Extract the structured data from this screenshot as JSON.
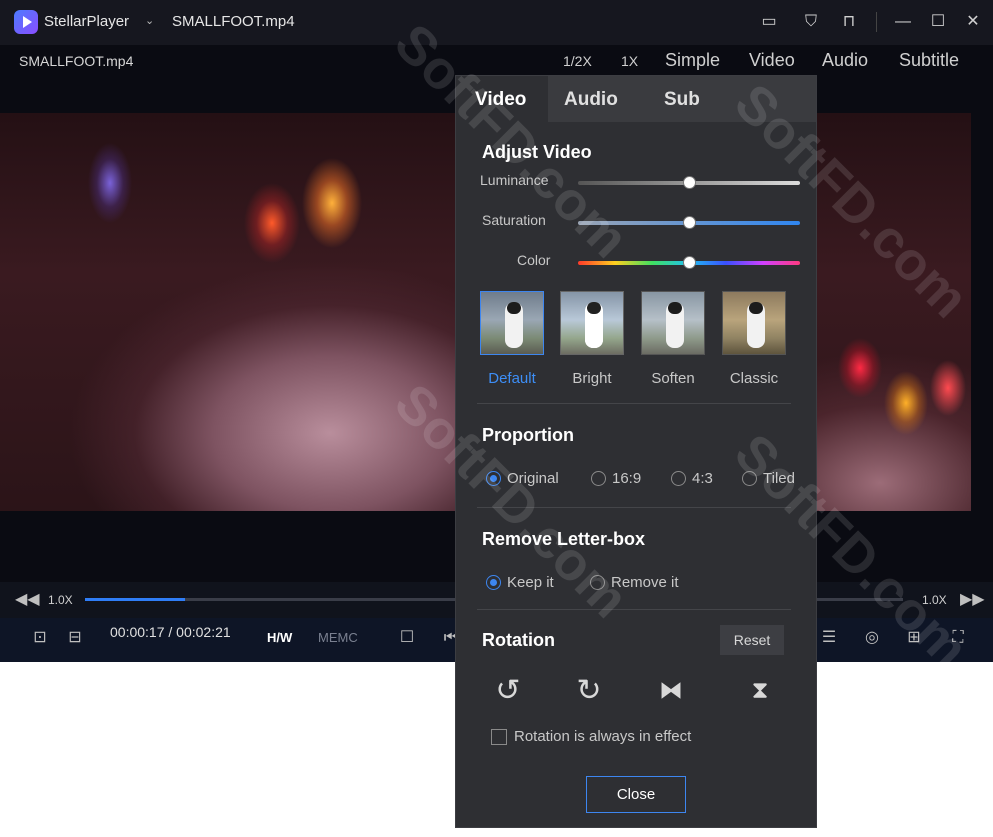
{
  "titlebar": {
    "app_name": "StellarPlayer",
    "file_title": "SMALLFOOT.mp4",
    "icons": [
      "feedback-icon",
      "skin-icon",
      "pin-icon",
      "minimize-icon",
      "maximize-icon",
      "close-icon"
    ]
  },
  "menu": {
    "file_label": "SMALLFOOT.mp4",
    "modes": [
      "1/2X",
      "1X",
      "Simple",
      "Video",
      "Audio",
      "Subtitle"
    ]
  },
  "progress": {
    "left_speed": "1.0X",
    "right_speed": "1.0X",
    "played_fraction": 0.27
  },
  "controls": {
    "time": "00:00:17 / 00:02:21",
    "hw": "H/W",
    "memc": "MEMC"
  },
  "panel": {
    "tabs": [
      "Video",
      "Audio",
      "Sub"
    ],
    "adjust_title": "Adjust Video",
    "sliders": [
      {
        "label": "Luminance",
        "value": 0.5
      },
      {
        "label": "Saturation",
        "value": 0.5
      },
      {
        "label": "Color",
        "value": 0.5
      }
    ],
    "presets": [
      "Default",
      "Bright",
      "Soften",
      "Classic"
    ],
    "proportion_title": "Proportion",
    "proportion_options": [
      "Original",
      "16:9",
      "4:3",
      "Tiled"
    ],
    "letterbox_title": "Remove Letter-box",
    "letterbox_options": [
      "Keep it",
      "Remove it"
    ],
    "rotation_title": "Rotation",
    "reset_label": "Reset",
    "rotation_check": "Rotation is always in effect",
    "close_label": "Close"
  },
  "watermark": "SoftFD.com",
  "colors": {
    "accent": "#3d86f0",
    "panel_bg": "#2e2f33"
  }
}
